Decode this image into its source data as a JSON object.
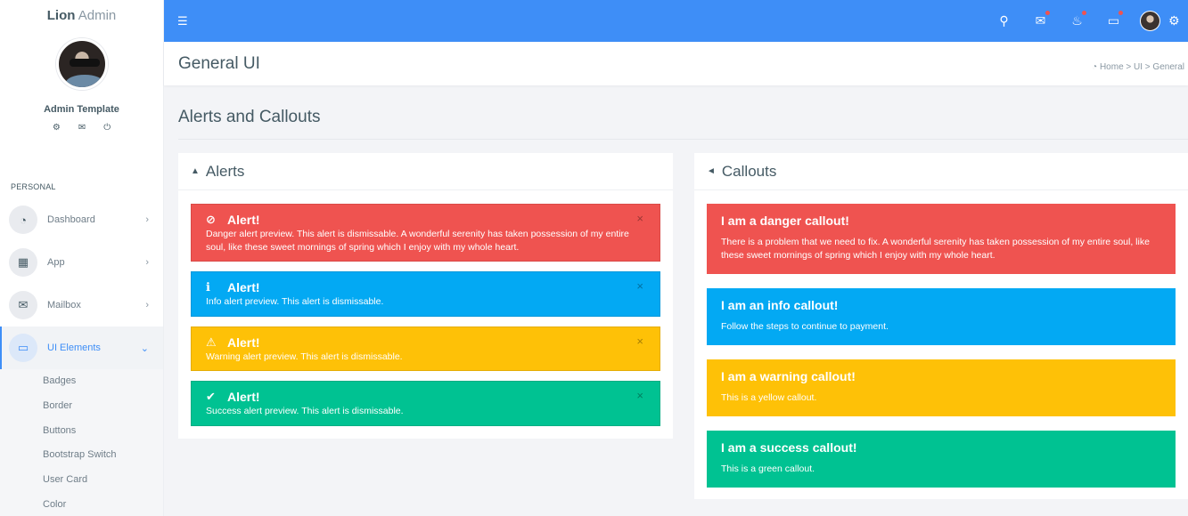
{
  "brand": {
    "bold": "Lion",
    "light": "Admin"
  },
  "profile": {
    "name": "Admin Template",
    "icons": [
      "gear-icon",
      "mail-icon",
      "power-icon"
    ]
  },
  "sidebar": {
    "section": "PERSONAL",
    "items": [
      {
        "label": "Dashboard",
        "icon": "dashboard-icon"
      },
      {
        "label": "App",
        "icon": "grid-icon"
      },
      {
        "label": "Mailbox",
        "icon": "mail-icon"
      },
      {
        "label": "UI Elements",
        "icon": "laptop-icon"
      }
    ],
    "submenu": [
      "Badges",
      "Border",
      "Buttons",
      "Bootstrap Switch",
      "User Card",
      "Color"
    ]
  },
  "header": {
    "title": "General UI",
    "breadcrumb": "Home > UI > General"
  },
  "section": {
    "title": "Alerts and Callouts"
  },
  "alerts": {
    "title": "Alerts",
    "items": [
      {
        "title": "Alert!",
        "text": "Danger alert preview. This alert is dismissable. A wonderful serenity has taken possession of my entire soul, like these sweet mornings of spring which I enjoy with my whole heart.",
        "icon": "ban-icon",
        "color": "#ef5350"
      },
      {
        "title": "Alert!",
        "text": "Info alert preview. This alert is dismissable.",
        "icon": "info-icon",
        "color": "#03a9f3"
      },
      {
        "title": "Alert!",
        "text": "Warning alert preview. This alert is dismissable.",
        "icon": "warning-icon",
        "color": "#fec107"
      },
      {
        "title": "Alert!",
        "text": "Success alert preview. This alert is dismissable.",
        "icon": "check-icon",
        "color": "#00c292"
      }
    ]
  },
  "callouts": {
    "title": "Callouts",
    "items": [
      {
        "title": "I am a danger callout!",
        "text": "There is a problem that we need to fix. A wonderful serenity has taken possession of my entire soul, like these sweet mornings of spring which I enjoy with my whole heart.",
        "color": "#ef5350"
      },
      {
        "title": "I am an info callout!",
        "text": "Follow the steps to continue to payment.",
        "color": "#03a9f3"
      },
      {
        "title": "I am a warning callout!",
        "text": "This is a yellow callout.",
        "color": "#fec107"
      },
      {
        "title": "I am a success callout!",
        "text": "This is a green callout.",
        "color": "#00c292"
      }
    ]
  },
  "colors": {
    "primary": "#3e8ef7",
    "sidebar_bg": "#ffffff",
    "page_bg": "#f3f4f7"
  }
}
